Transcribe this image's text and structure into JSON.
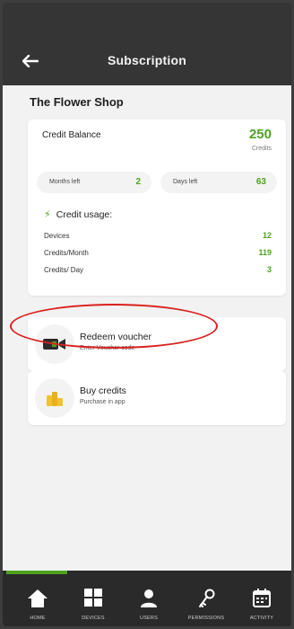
{
  "header": {
    "title": "Subscription",
    "back_icon": "arrow-left-icon"
  },
  "shop": {
    "name": "The Flower Shop"
  },
  "balance": {
    "title": "Credit Balance",
    "value": "250",
    "unit": "Credits",
    "months_label": "Months left",
    "months_value": "2",
    "days_label": "Days left",
    "days_value": "63"
  },
  "usage": {
    "title": "Credit usage:",
    "rows": [
      {
        "label": "Devices",
        "value": "12"
      },
      {
        "label": "Credits/Month",
        "value": "119"
      },
      {
        "label": "Credits/ Day",
        "value": "3"
      }
    ]
  },
  "actions": {
    "voucher": {
      "title": "Redeem voucher",
      "subtitle": "Enter Voucher code",
      "icon": "camera-icon"
    },
    "buy": {
      "title": "Buy credits",
      "subtitle": "Purchase in app",
      "icon": "coins-icon"
    }
  },
  "nav": {
    "items": [
      {
        "label": "HOME",
        "icon": "home-icon"
      },
      {
        "label": "DEVICES",
        "icon": "grid-icon"
      },
      {
        "label": "USERS",
        "icon": "user-icon"
      },
      {
        "label": "PERMISSIONS",
        "icon": "key-icon"
      },
      {
        "label": "ACTIVITY",
        "icon": "calendar-icon"
      }
    ]
  },
  "colors": {
    "accent": "#4fa21f",
    "annotation": "#d9221f",
    "header": "#353535",
    "navbar": "#2a2a2a"
  }
}
